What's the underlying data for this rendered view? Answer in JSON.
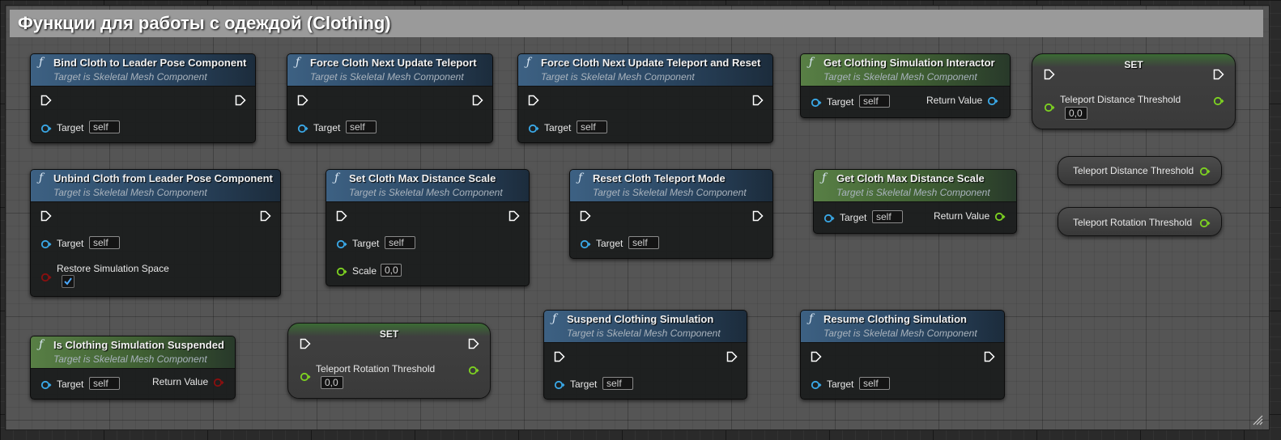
{
  "comment": {
    "title": "Функции для работы с одеждой (Clothing)"
  },
  "common": {
    "target_label": "Target",
    "self_value": "self",
    "subtitle": "Target is Skeletal Mesh Component",
    "return_value_label": "Return Value",
    "function_icon": "ƒ"
  },
  "colors": {
    "exec_pin": "#ffffff",
    "object_pin": "#3aa9e8",
    "float_pin": "#7ed321",
    "bool_pin": "#8b0f0f",
    "function_header_blue": "#3d6183",
    "pure_header_green": "#587f45"
  },
  "nodes": {
    "bind_cloth": {
      "title": "Bind Cloth to Leader Pose Component"
    },
    "force_teleport": {
      "title": "Force Cloth Next Update Teleport"
    },
    "force_teleport_reset": {
      "title": "Force Cloth Next Update Teleport and Reset"
    },
    "get_interactor": {
      "title": "Get Clothing Simulation Interactor"
    },
    "set_distance": {
      "title": "SET",
      "var_label": "Teleport Distance Threshold",
      "value": "0,0"
    },
    "get_teleport_distance": {
      "label": "Teleport Distance Threshold"
    },
    "get_teleport_rotation": {
      "label": "Teleport Rotation Threshold"
    },
    "unbind_cloth": {
      "title": "Unbind Cloth from Leader Pose Component",
      "restore_label": "Restore Simulation Space",
      "restore_checked": true
    },
    "set_max_distance": {
      "title": "Set Cloth Max Distance Scale",
      "scale_label": "Scale",
      "scale_value": "0,0"
    },
    "reset_teleport": {
      "title": "Reset Cloth Teleport Mode"
    },
    "get_max_distance": {
      "title": "Get Cloth Max Distance Scale"
    },
    "is_suspended": {
      "title": "Is Clothing Simulation Suspended"
    },
    "set_rotation": {
      "title": "SET",
      "var_label": "Teleport Rotation Threshold",
      "value": "0,0"
    },
    "suspend": {
      "title": "Suspend Clothing Simulation"
    },
    "resume": {
      "title": "Resume Clothing Simulation"
    }
  }
}
